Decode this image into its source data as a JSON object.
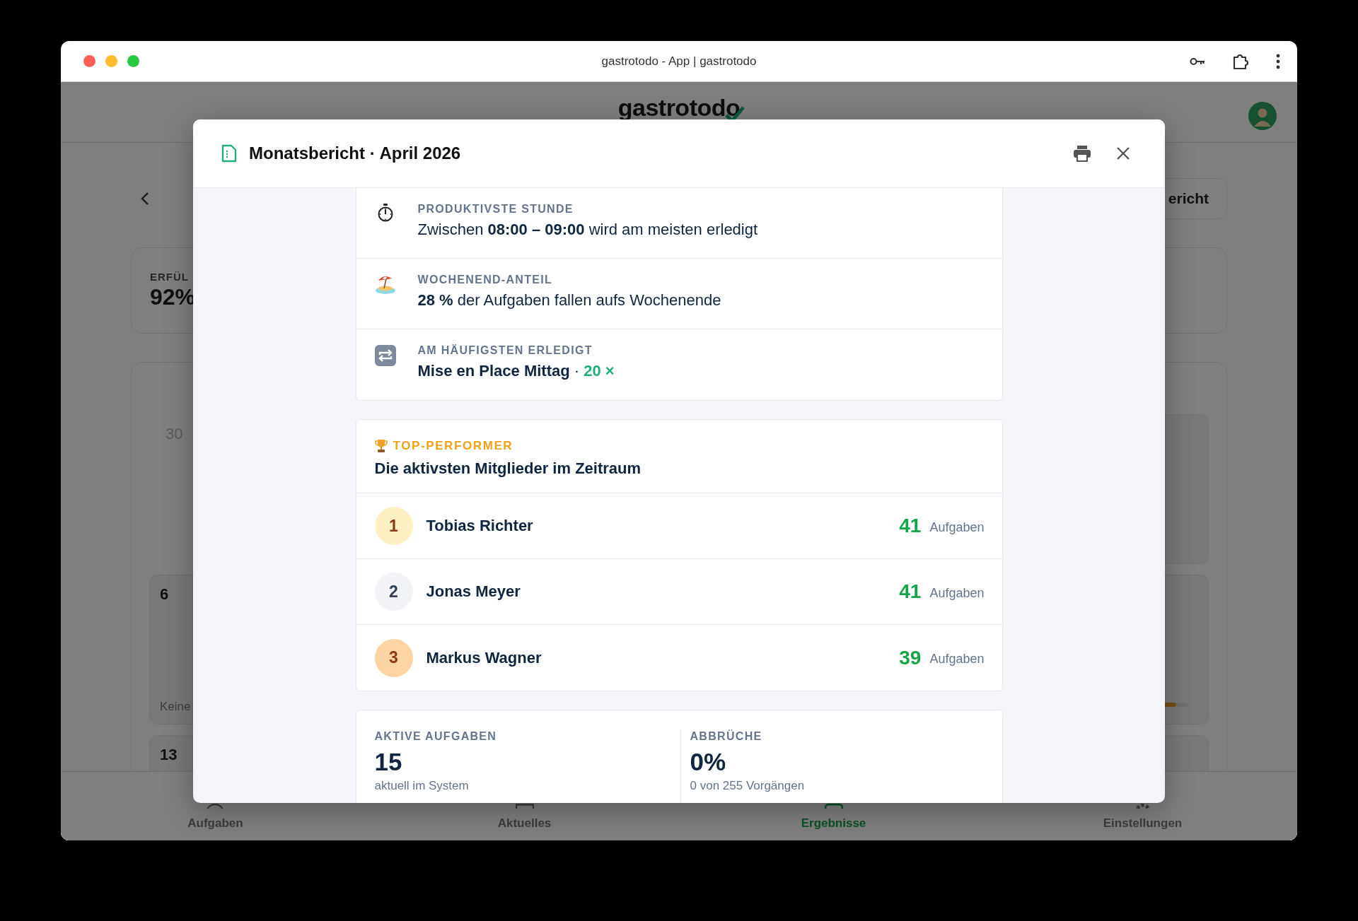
{
  "window": {
    "title": "gastrotodo - App | gastrotodo"
  },
  "app": {
    "logo": "gastrotodo",
    "report_button": "ericht",
    "summary_card": {
      "label": "ERFÜL",
      "value": "92%"
    },
    "calendar": {
      "cells": [
        {
          "kind": "outside",
          "day": "30"
        },
        {
          "kind": "day",
          "day": "6",
          "note": "Keine"
        },
        {
          "kind": "day",
          "day": "13"
        }
      ],
      "progress": {
        "level": 0.88
      }
    }
  },
  "bottom_nav": [
    {
      "label": "Aufgaben",
      "selected": false
    },
    {
      "label": "Aktuelles",
      "selected": false
    },
    {
      "label": "Ergebnisse",
      "selected": true
    },
    {
      "label": "Einstellungen",
      "selected": false
    }
  ],
  "modal": {
    "title": "Monatsbericht · April 2026",
    "insights": [
      {
        "kind": "stopwatch",
        "label": "PRODUKTIVSTE STUNDE",
        "text": "Zwischen **08:00 – 09:00** wird am meisten erledigt"
      },
      {
        "kind": "beach",
        "label": "WOCHENEND-ANTEIL",
        "text": "**28 %** der Aufgaben fallen aufs Wochenende"
      },
      {
        "kind": "repeat",
        "label": "AM HÄUFIGSTEN ERLEDIGT",
        "text": "Mise en Place Mittag",
        "separator": "·",
        "count": "20 ×"
      }
    ],
    "top_performers": {
      "label": "TOP-PERFORMER",
      "subtitle": "Die aktivsten Mitglieder im Zeitraum",
      "members": [
        {
          "kind": "gold",
          "rank": "1",
          "name": "Tobias Richter",
          "count": "41",
          "unit": "Aufgaben"
        },
        {
          "kind": "silver",
          "rank": "2",
          "name": "Jonas Meyer",
          "count": "41",
          "unit": "Aufgaben"
        },
        {
          "kind": "bronze",
          "rank": "3",
          "name": "Markus Wagner",
          "count": "39",
          "unit": "Aufgaben"
        }
      ]
    },
    "stats": [
      {
        "label": "AKTIVE AUFGABEN",
        "value": "15",
        "note": "aktuell im System"
      },
      {
        "label": "ABBRÜCHE",
        "value": "0%",
        "note": "0 von 255 Vorgängen"
      }
    ]
  }
}
